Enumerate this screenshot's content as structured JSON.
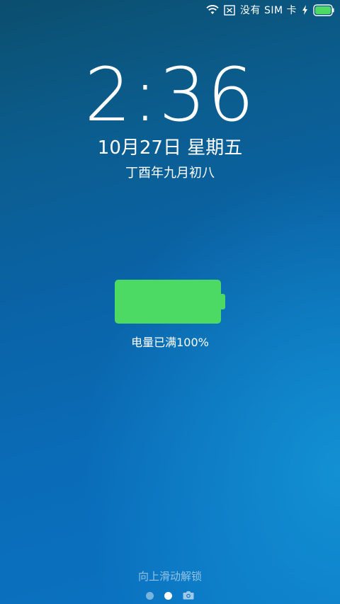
{
  "status_bar": {
    "carrier_text": "没有 SIM 卡",
    "icons": [
      "wifi-icon",
      "no-sim-icon",
      "charging-bolt-icon",
      "battery-icon"
    ],
    "battery_color": "#4cd964"
  },
  "lockscreen": {
    "time": "2:36",
    "date": "10月27日 星期五",
    "lunar_date": "丁酉年九月初八"
  },
  "charging": {
    "label": "电量已满100%",
    "level": 1.0,
    "color": "#4cd964"
  },
  "footer": {
    "unlock_hint": "向上滑动解锁",
    "pages": [
      "page-dot",
      "page-dot-active",
      "camera-icon"
    ]
  }
}
